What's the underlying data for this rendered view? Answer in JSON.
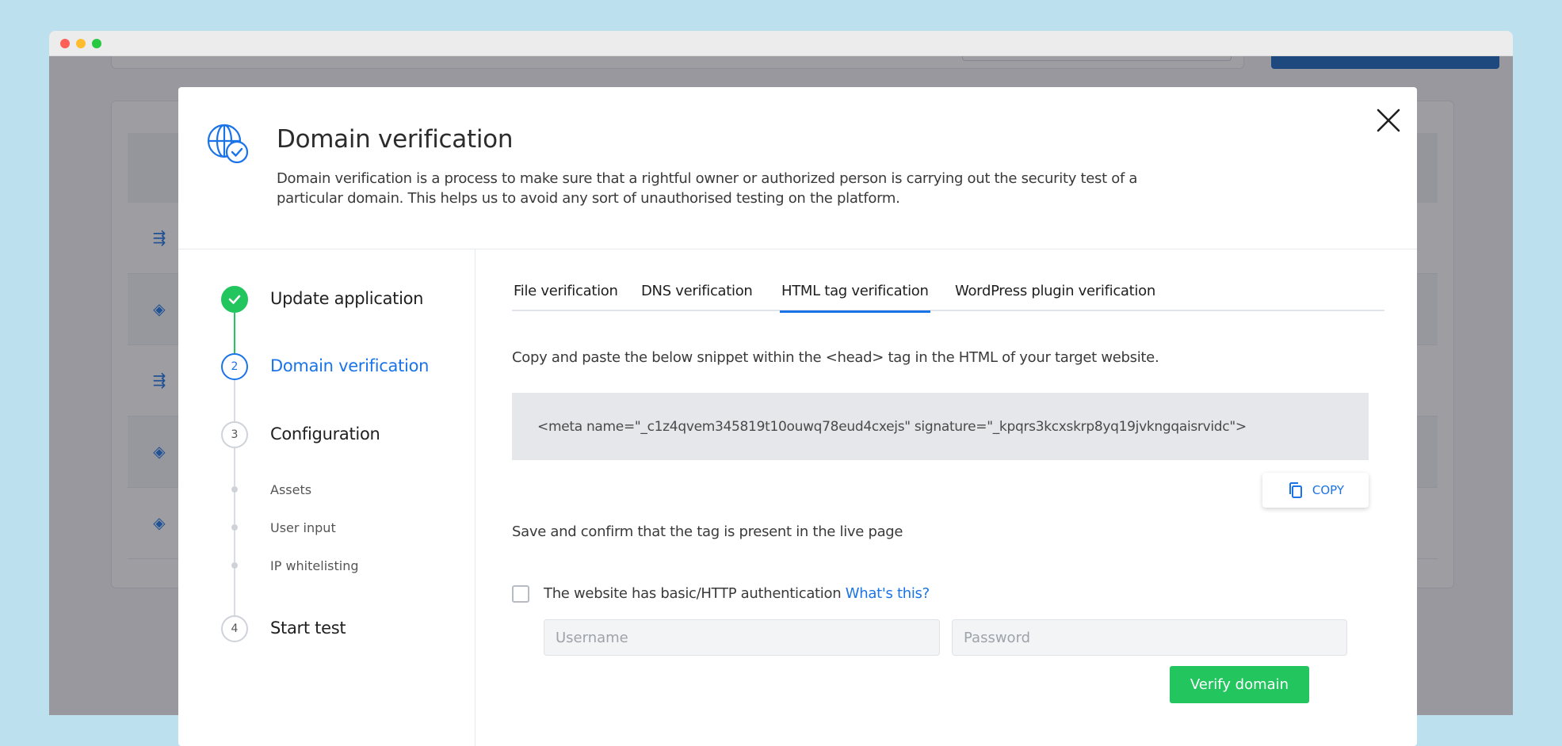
{
  "window": {
    "controls": [
      "close",
      "minimize",
      "zoom"
    ]
  },
  "modal": {
    "title": "Domain verification",
    "description": "Domain verification is a process to make sure that a rightful owner or authorized person is carrying out the security test of a particular domain. This helps us to avoid any sort of unauthorised testing on the platform.",
    "icon": "globe-check-icon",
    "close_icon": "close-icon"
  },
  "steps": [
    {
      "number": "1",
      "label": "Update application",
      "status": "done"
    },
    {
      "number": "2",
      "label": "Domain verification",
      "status": "active"
    },
    {
      "number": "3",
      "label": "Configuration",
      "status": "pending"
    },
    {
      "number": "4",
      "label": "Start test",
      "status": "pending"
    }
  ],
  "substeps": [
    "Assets",
    "User input",
    "IP whitelisting"
  ],
  "tabs": [
    {
      "label": "File verification"
    },
    {
      "label": "DNS verification"
    },
    {
      "label": "HTML tag verification",
      "active": true
    },
    {
      "label": "WordPress plugin verification"
    }
  ],
  "content": {
    "instruction": "Copy and paste the below snippet within the <head> tag in the HTML of your target website.",
    "snippet": "<meta name=\"_c1z4qvem345819t10ouwq78eud4cxejs\" signature=\"_kpqrs3kcxskrp8yq19jvkngqaisrvidc\">",
    "copy_label": "COPY",
    "confirm_text": "Save and confirm that the tag is present in the live page",
    "auth_text": "The website has basic/HTTP authentication",
    "auth_link": "What's this?",
    "username_placeholder": "Username",
    "password_placeholder": "Password",
    "username_value": "",
    "password_value": "",
    "auth_checked": false,
    "verify_label": "Verify domain"
  },
  "colors": {
    "accent": "#1a73e8",
    "success": "#22c55e",
    "background": "#bde0ef"
  }
}
